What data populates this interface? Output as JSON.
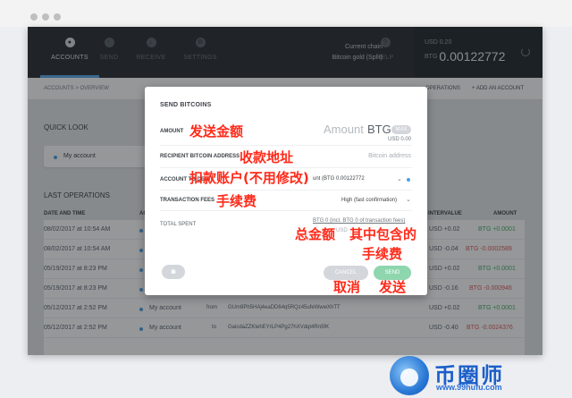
{
  "nav": {
    "items": [
      {
        "label": "ACCOUNTS",
        "icon": "accounts-icon"
      },
      {
        "label": "SEND",
        "icon": "send-icon"
      },
      {
        "label": "RECEIVE",
        "icon": "receive-icon"
      },
      {
        "label": "SETTINGS",
        "icon": "settings-icon"
      }
    ],
    "chain_label": "Current chain",
    "chain_value": "Bitcoin gold (Split)",
    "help_label": "HELP"
  },
  "balance": {
    "fiat": "USD 0.20",
    "unit": "BTG",
    "amount": "0.00122772"
  },
  "subheader": {
    "breadcrumb": "ACCOUNTS > OVERVIEW",
    "operations_link": "OPERATIONS",
    "add_account": "+ ADD AN ACCOUNT"
  },
  "quick_look": {
    "title": "QUICK LOOK",
    "account_label": "My account"
  },
  "last_operations": {
    "title": "LAST OPERATIONS",
    "headers": {
      "date": "DATE AND TIME",
      "account": "AC",
      "countervalue": "INTERVALUE",
      "amount": "AMOUNT"
    },
    "rows": [
      {
        "date": "08/02/2017 at 10:54 AM",
        "account": "",
        "dir": "",
        "address": "",
        "counter": "USD +0.02",
        "amount": "BTG +0.0001",
        "sign": "pos"
      },
      {
        "date": "08/02/2017 at 10:54 AM",
        "account": "",
        "dir": "",
        "address": "",
        "counter": "USD -0.04",
        "amount": "BTG -0.0002589",
        "sign": "neg"
      },
      {
        "date": "05/19/2017 at 8:23 PM",
        "account": "",
        "dir": "",
        "address": "",
        "counter": "USD +0.02",
        "amount": "BTG +0.0001",
        "sign": "pos"
      },
      {
        "date": "05/19/2017 at 8:23 PM",
        "account": "",
        "dir": "",
        "address": "",
        "counter": "USD -0.16",
        "amount": "BTG -0.000946",
        "sign": "neg"
      },
      {
        "date": "05/12/2017 at 2:52 PM",
        "account": "My account",
        "dir": "from",
        "address": "GUm9Ph5HAj4eaDD64q5RQz45ufeWwwXhTT",
        "counter": "USD +0.02",
        "amount": "BTG +0.0001",
        "sign": "pos"
      },
      {
        "date": "05/12/2017 at 2:52 PM",
        "account": "My account",
        "dir": "to",
        "address": "GaicdaZZKtehEYrLP4Pg27hXVdqt4Rn5fK",
        "counter": "USD -0.40",
        "amount": "BTG -0.0024376",
        "sign": "neg"
      }
    ]
  },
  "modal": {
    "title": "SEND BITCOINS",
    "amount_label": "AMOUNT",
    "amount_placeholder": "Amount",
    "amount_unit": "BTG",
    "max_label": "MAX",
    "amount_usd": "USD 0.00",
    "recipient_label": "RECIPIENT BITCOIN ADDRESS",
    "recipient_placeholder": "Bitcoin address",
    "debit_label": "ACCOUNT TO DEBIT",
    "debit_value": "unt (BTG 0.00122772",
    "fees_label": "TRANSACTION FEES",
    "fees_value": "High (fast confirmation)",
    "total_label": "TOTAL SPENT",
    "total_value": "BTG 0 (incl. BTG 0 of transaction fees)",
    "total_usd": "USD",
    "cancel_label": "CANCEL",
    "send_label": "SEND"
  },
  "annotations": {
    "amount": "发送金额",
    "address": "收款地址",
    "debit": "扣款账户(不用修改)",
    "fees": "手续费",
    "total": "总金额",
    "includes": "其中包含的",
    "includes_fee": "手续费",
    "cancel": "取消",
    "send": "发送"
  },
  "watermark": {
    "title": "币圈师",
    "url": "www.99hufu.com"
  }
}
